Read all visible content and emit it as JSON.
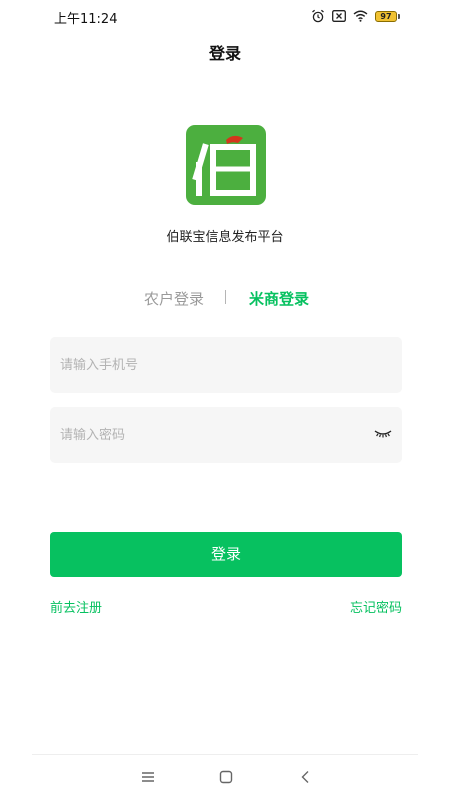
{
  "status_bar": {
    "time": "上午11:24",
    "battery_level": "97",
    "icons": [
      "alarm-icon",
      "notification-x-icon",
      "wifi-icon",
      "battery-icon"
    ]
  },
  "header": {
    "title": "登录"
  },
  "brand": {
    "logo_char": "伯",
    "logo_color": "#4caf3f",
    "app_name": "伯联宝信息发布平台"
  },
  "tabs": {
    "farmer_label": "农户登录",
    "merchant_label": "米商登录",
    "active": "merchant"
  },
  "form": {
    "phone_placeholder": "请输入手机号",
    "password_placeholder": "请输入密码",
    "login_label": "登录"
  },
  "links": {
    "register": "前去注册",
    "forgot": "忘记密码"
  },
  "colors": {
    "accent": "#07c160",
    "field_bg": "#f6f6f6",
    "inactive_tab": "#9a9a9a"
  },
  "system_nav": [
    "menu-icon",
    "home-icon",
    "back-icon"
  ]
}
